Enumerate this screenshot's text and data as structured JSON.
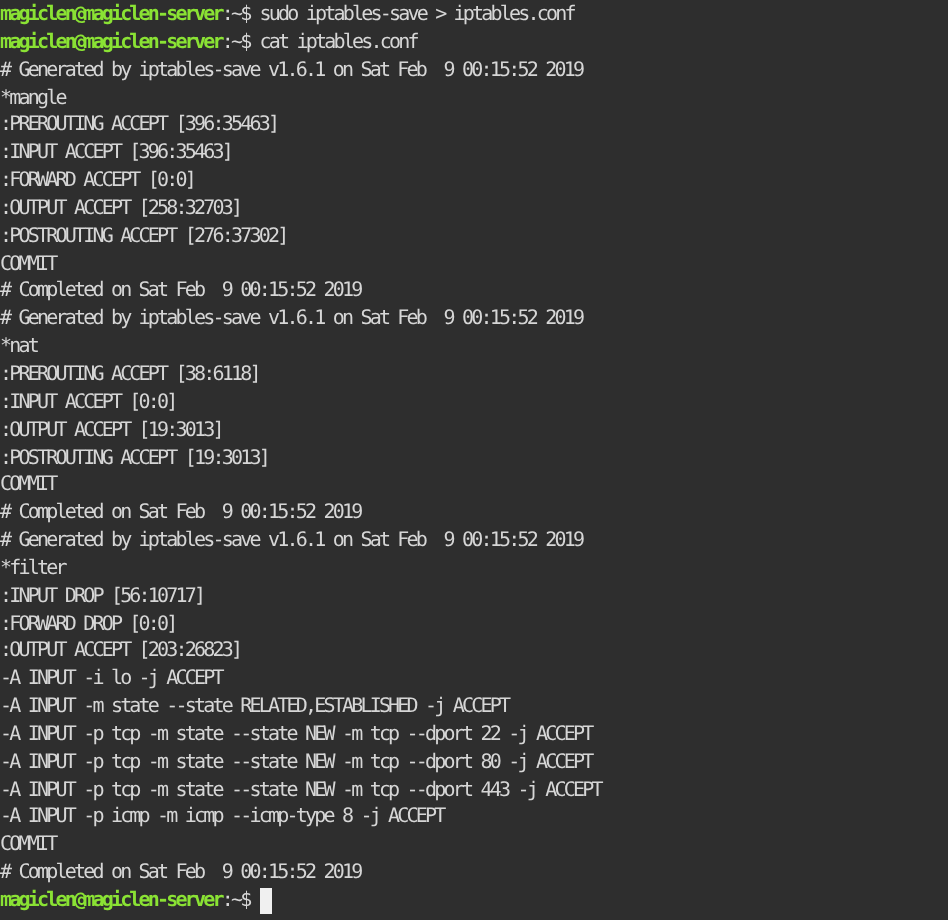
{
  "terminal": {
    "lines": [
      {
        "kind": "prompt",
        "user": "magiclen@magiclen-server",
        "path": ":~$",
        "command": "sudo iptables-save > iptables.conf"
      },
      {
        "kind": "prompt",
        "user": "magiclen@magiclen-server",
        "path": ":~$",
        "command": "cat iptables.conf"
      },
      {
        "kind": "output",
        "text": "# Generated by iptables-save v1.6.1 on Sat Feb  9 00:15:52 2019"
      },
      {
        "kind": "output",
        "text": "*mangle"
      },
      {
        "kind": "output",
        "text": ":PREROUTING ACCEPT [396:35463]"
      },
      {
        "kind": "output",
        "text": ":INPUT ACCEPT [396:35463]"
      },
      {
        "kind": "output",
        "text": ":FORWARD ACCEPT [0:0]"
      },
      {
        "kind": "output",
        "text": ":OUTPUT ACCEPT [258:32703]"
      },
      {
        "kind": "output",
        "text": ":POSTROUTING ACCEPT [276:37302]"
      },
      {
        "kind": "output",
        "text": "COMMIT"
      },
      {
        "kind": "output",
        "text": "# Completed on Sat Feb  9 00:15:52 2019"
      },
      {
        "kind": "output",
        "text": "# Generated by iptables-save v1.6.1 on Sat Feb  9 00:15:52 2019"
      },
      {
        "kind": "output",
        "text": "*nat"
      },
      {
        "kind": "output",
        "text": ":PREROUTING ACCEPT [38:6118]"
      },
      {
        "kind": "output",
        "text": ":INPUT ACCEPT [0:0]"
      },
      {
        "kind": "output",
        "text": ":OUTPUT ACCEPT [19:3013]"
      },
      {
        "kind": "output",
        "text": ":POSTROUTING ACCEPT [19:3013]"
      },
      {
        "kind": "output",
        "text": "COMMIT"
      },
      {
        "kind": "output",
        "text": "# Completed on Sat Feb  9 00:15:52 2019"
      },
      {
        "kind": "output",
        "text": "# Generated by iptables-save v1.6.1 on Sat Feb  9 00:15:52 2019"
      },
      {
        "kind": "output",
        "text": "*filter"
      },
      {
        "kind": "output",
        "text": ":INPUT DROP [56:10717]"
      },
      {
        "kind": "output",
        "text": ":FORWARD DROP [0:0]"
      },
      {
        "kind": "output",
        "text": ":OUTPUT ACCEPT [203:26823]"
      },
      {
        "kind": "output",
        "text": "-A INPUT -i lo -j ACCEPT"
      },
      {
        "kind": "output",
        "text": "-A INPUT -m state --state RELATED,ESTABLISHED -j ACCEPT"
      },
      {
        "kind": "output",
        "text": "-A INPUT -p tcp -m state --state NEW -m tcp --dport 22 -j ACCEPT"
      },
      {
        "kind": "output",
        "text": "-A INPUT -p tcp -m state --state NEW -m tcp --dport 80 -j ACCEPT"
      },
      {
        "kind": "output",
        "text": "-A INPUT -p tcp -m state --state NEW -m tcp --dport 443 -j ACCEPT"
      },
      {
        "kind": "output",
        "text": "-A INPUT -p icmp -m icmp --icmp-type 8 -j ACCEPT"
      },
      {
        "kind": "output",
        "text": "COMMIT"
      },
      {
        "kind": "output",
        "text": "# Completed on Sat Feb  9 00:15:52 2019"
      },
      {
        "kind": "prompt",
        "user": "magiclen@magiclen-server",
        "path": ":~$",
        "cursor": true
      }
    ]
  }
}
